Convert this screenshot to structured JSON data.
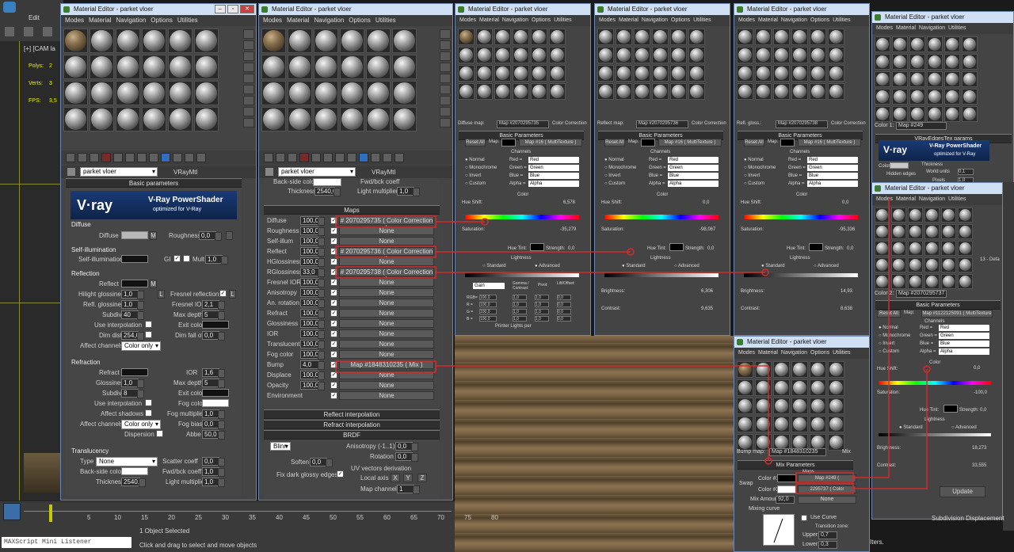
{
  "app": {
    "menu": [
      "Edit"
    ],
    "viewport_label": "[+] [CAM la",
    "stats": {
      "polys": "Polys:",
      "verts": "Verts:",
      "fps": "FPS:",
      "num_polys": "2",
      "num_verts": "3",
      "num_fps": "3,5"
    }
  },
  "editor_main": {
    "title": "Material Editor - parket vloer",
    "menu": [
      "Modes",
      "Material",
      "Navigation",
      "Options",
      "Utilities"
    ],
    "material_name": "parket vloer",
    "material_type": "VRayMtl",
    "basic_params": "Basic parameters",
    "vray_logo": "V·ray",
    "vray_title": "V-Ray PowerShader",
    "vray_sub": "optimized for V-Ray",
    "diffuse": {
      "group": "Diffuse",
      "diffuse": "Diffuse",
      "m": "M",
      "roughness": "Roughness",
      "roughness_val": "0,0"
    },
    "selfillum": {
      "group": "Self-illumination",
      "label": "Self-illumination",
      "gi": "GI",
      "mult": "Mult",
      "mult_val": "1,0"
    },
    "reflection": {
      "group": "Reflection",
      "reflect": "Reflect",
      "hilight": "Hilight glossiness",
      "hilight_val": "1,0",
      "l": "L",
      "fresnel": "Fresnel reflections",
      "refl_gloss": "Refl. glossiness",
      "refl_gloss_val": "1,0",
      "fresnel_ior": "Fresnel IOR",
      "fresnel_ior_val": "2,1",
      "subdivs": "Subdivs",
      "subdivs_val": "40",
      "max_depth": "Max depth",
      "max_depth_val": "5",
      "use_interp": "Use interpolation",
      "exit_color": "Exit color",
      "dim_dist": "Dim distance",
      "dim_dist_val": "254,0",
      "dim_falloff": "Dim fall off",
      "dim_falloff_val": "0,0",
      "affect_ch": "Affect channels",
      "affect_val": "Color only"
    },
    "refraction": {
      "group": "Refraction",
      "refract": "Refract",
      "ior": "IOR",
      "ior_val": "1,6",
      "glossiness": "Glossiness",
      "gloss_val": "1,0",
      "max_depth": "Max depth",
      "max_depth_val": "5",
      "subdivs": "Subdivs",
      "subdivs_val": "8",
      "exit_color": "Exit color",
      "use_interp": "Use interpolation",
      "fog_color": "Fog color",
      "affect_shadows": "Affect shadows",
      "fog_mult": "Fog multiplier",
      "fog_mult_val": "1,0",
      "affect_ch": "Affect channels",
      "affect_val": "Color only",
      "fog_bias": "Fog bias",
      "fog_bias_val": "0,0",
      "dispersion": "Dispersion",
      "abbe": "Abbe",
      "abbe_val": "50,0"
    },
    "translucency": {
      "group": "Translucency",
      "type": "Type",
      "type_val": "None",
      "scatter": "Scatter coeff",
      "scatter_val": "0,0",
      "back_side": "Back-side color",
      "fwd_bck": "Fwd/bck coeff",
      "fwd_bck_val": "1,0",
      "thickness": "Thickness",
      "thickness_val": "2540,0",
      "light_mult": "Light multiplier",
      "light_mult_val": "1,0"
    }
  },
  "editor_maps": {
    "title": "Material Editor - parket vloer",
    "menu": [
      "Modes",
      "Material",
      "Navigation",
      "Options",
      "Utilities"
    ],
    "material_name": "parket vloer",
    "material_type": "VRayMtl",
    "top": {
      "back_side": "Back-side color",
      "fwd": "Fwd/bck coeff",
      "thickness": "Thickness",
      "thickness_val": "2540,0",
      "light_mult": "Light multiplier",
      "light_mult_val": "1,0"
    },
    "maps_header": "Maps",
    "maps": [
      {
        "name": "Diffuse",
        "amount": "100,0",
        "map": "# 2070295735 ( Color Correction )"
      },
      {
        "name": "Roughness",
        "amount": "100,0",
        "map": "None"
      },
      {
        "name": "Self-illum",
        "amount": "100,0",
        "map": "None"
      },
      {
        "name": "Reflect",
        "amount": "100,0",
        "map": "# 2070295736 ( Color Correction )"
      },
      {
        "name": "HGlossiness",
        "amount": "100,0",
        "map": "None"
      },
      {
        "name": "RGlossiness",
        "amount": "33,0",
        "map": "# 2070295738 ( Color Correction )"
      },
      {
        "name": "Fresnel IOR",
        "amount": "100,0",
        "map": "None"
      },
      {
        "name": "Anisotropy",
        "amount": "100,0",
        "map": "None"
      },
      {
        "name": "An. rotation",
        "amount": "100,0",
        "map": "None"
      },
      {
        "name": "Refract",
        "amount": "100,0",
        "map": "None"
      },
      {
        "name": "Glossiness",
        "amount": "100,0",
        "map": "None"
      },
      {
        "name": "IOR",
        "amount": "100,0",
        "map": "None"
      },
      {
        "name": "Translucent",
        "amount": "100,0",
        "map": "None"
      },
      {
        "name": "Fog color",
        "amount": "100,0",
        "map": "None"
      },
      {
        "name": "Bump",
        "amount": "4,0",
        "map": "Map #1848310235  ( Mix )"
      },
      {
        "name": "Displace",
        "amount": "100,0",
        "map": "None"
      },
      {
        "name": "Opacity",
        "amount": "100,0",
        "map": "None"
      },
      {
        "name": "Environment",
        "amount": "",
        "map": "None"
      }
    ],
    "reflect_interp": "Reflect interpolation",
    "refract_interp": "Refract interpolation",
    "brdf": {
      "header": "BRDF",
      "type": "Blinn",
      "aniso": "Anisotropy (-1..1)",
      "aniso_val": "0,0",
      "rotation": "Rotation",
      "rotation_val": "0,0",
      "soften": "Soften",
      "soften_val": "0,0",
      "uv_deriv": "UV vectors derivation",
      "fix_dark": "Fix dark glossy edges",
      "local_axis": "Local axis",
      "x": "X",
      "y": "Y",
      "z": "Z",
      "map_channel": "Map channel",
      "map_channel_val": "1"
    }
  },
  "cc_editors": [
    {
      "title": "Material Editor - parket vloer",
      "slot_label": "Diffuse map:",
      "map_name": "Map #2070295735",
      "map_type": "Color Correction",
      "hue_shift": "6,578",
      "saturation": "-35,279",
      "brightness": "",
      "contrast": "",
      "lightness_mode": "Advanced"
    },
    {
      "title": "Material Editor - parket vloer",
      "slot_label": "Reflect map:",
      "map_name": "Map #2070295736",
      "map_type": "Color Correction",
      "hue_shift": "0,0",
      "saturation": "-98,067",
      "brightness": "6,306",
      "contrast": "9,635",
      "lightness_mode": "Standard"
    },
    {
      "title": "Material Editor - parket vloer",
      "slot_label": "Refl. gloss.:",
      "map_name": "Map #2070295738",
      "map_type": "Color Correction",
      "hue_shift": "0,0",
      "saturation": "-95,336",
      "brightness": "14,93",
      "contrast": "8,638",
      "lightness_mode": "Standard"
    }
  ],
  "cc_common": {
    "menu": [
      "Modes",
      "Material",
      "Navigation",
      "Options",
      "Utilities"
    ],
    "basic_params": "Basic Parameters",
    "reset_all": "Reset All",
    "map": "Map:",
    "map_val": "Map #16  ( MultiTexture )",
    "channels": "Channels",
    "normal": "Normal",
    "mono": "Monochrome",
    "invert": "Invert",
    "custom": "Custom",
    "red": "Red =",
    "green": "Green =",
    "blue": "Blue =",
    "alpha": "Alpha =",
    "red_v": "Red",
    "green_v": "Green",
    "blue_v": "Blue",
    "alpha_v": "Alpha",
    "color": "Color",
    "hue_shift": "Hue Shift:",
    "saturation": "Saturation:",
    "hue_tint": "Hue Tint:",
    "strength": "Strength:",
    "strength_val": "0,0",
    "lightness": "Lightness",
    "standard": "Standard",
    "advanced": "Advanced",
    "brightness": "Brightness:",
    "contrast": "Contrast:",
    "gain": "Gain",
    "gamma": "Gamma / Contrast:",
    "pivot": "Pivot:",
    "lift": "Lift/Offset:",
    "rgb": "RGB=",
    "r": "R =",
    "g": "G =",
    "b": "B =",
    "one": "100,0",
    "onep": "1,0",
    "zero": "0,0",
    "printer": "Printer Lights per"
  },
  "mix_editor": {
    "title": "Material Editor - parket vloer",
    "menu": [
      "Modes",
      "Material",
      "Navigation",
      "Options",
      "Utilities"
    ],
    "slot_label": "Bump map:",
    "map_name": "Map #1848310235",
    "map_type": "Mix",
    "mix_params": "Mix Parameters",
    "swap": "Swap",
    "color1": "Color #1",
    "color2": "Color #2",
    "map1": "Map #249  ( VRayEdgesTex )",
    "map2": "2295737  ( Color Correction )",
    "maps": "Maps",
    "mix_amount": "Mix Amount:",
    "mix_amount_val": "92,0",
    "none": "None",
    "mixing_curve": "Mixing curve",
    "use_curve": "Use Curve",
    "transition": "Transition zone:",
    "upper": "Upper:",
    "upper_val": "0,7",
    "lower": "Lower:",
    "lower_val": "0,3"
  },
  "edges_editor": {
    "title": "Material Editor - parket vloer",
    "menu": [
      "Modes",
      "Material",
      "Navigation",
      "Utilities"
    ],
    "color_label": "Color 1:",
    "map_name": "Map #249",
    "params": "VRayEdgesTex params",
    "vray_title": "V-Ray PowerShader",
    "vray_sub": "optimized for V-Ray",
    "color": "Color",
    "hidden_edges": "Hidden edges",
    "thickness": "Thickness",
    "world_units": "World units",
    "world_val": "0,1",
    "pixels": "Pixels",
    "pixels_val": "1,0"
  },
  "cc4_editor": {
    "title": "Material Editor - parket vloer",
    "menu": [
      "Modes",
      "Material",
      "Navigation",
      "Utilities"
    ],
    "color_label": "Color 2:",
    "map_name": "Map #2070295737",
    "hue_shift": "0,0",
    "saturation": "-100,0",
    "brightness": "18,273",
    "contrast": "33,555",
    "lightness_mode": "Standard",
    "map_val": "Map #1122125091  ( MultiTexture )",
    "defa": "13 - Defa"
  },
  "right_panel": {
    "update": "Update",
    "subdiv": "Subdivision Displacement",
    "iters": "Iters."
  },
  "timeline": {
    "ticks": [
      "5",
      "10",
      "15",
      "20",
      "25",
      "30",
      "35",
      "40",
      "45",
      "50",
      "55",
      "60",
      "65",
      "70",
      "75",
      "80"
    ]
  },
  "status": {
    "maxscript": "MAXScript Mini Listener",
    "objects": "1 Object Selected",
    "hint": "Click and drag to select and move objects"
  },
  "colors": {
    "accent_red": "#d42b2b",
    "titlebar": "#cfe0f4",
    "panel": "#464646"
  }
}
